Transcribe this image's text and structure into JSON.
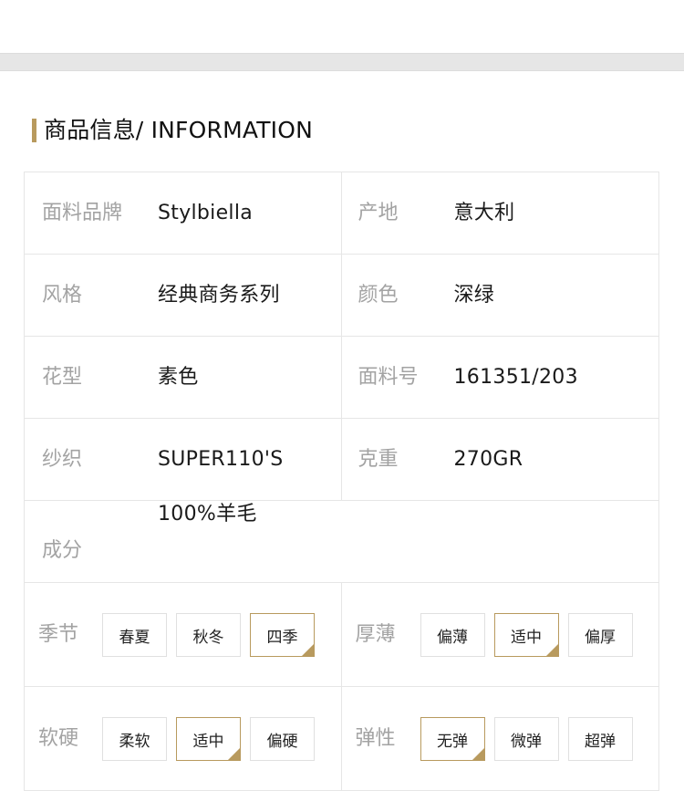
{
  "section": {
    "title": "商品信息/ INFORMATION"
  },
  "info_rows": [
    {
      "left_label": "面料品牌",
      "left_value": "Stylbiella",
      "right_label": "产地",
      "right_value": "意大利"
    },
    {
      "left_label": "风格",
      "left_value": "经典商务系列",
      "right_label": "颜色",
      "right_value": "深绿"
    },
    {
      "left_label": "花型",
      "left_value": "素色",
      "right_label": "面料号",
      "right_value": "161351/203"
    },
    {
      "left_label": "纱织",
      "left_value": "SUPER110'S",
      "right_label": "克重",
      "right_value": "270GR"
    }
  ],
  "composition": {
    "label": "成分",
    "value": "100%羊毛"
  },
  "attributes": {
    "season": {
      "label": "季节",
      "options": [
        "春夏",
        "秋冬",
        "四季"
      ],
      "selected": "四季"
    },
    "thickness": {
      "label": "厚薄",
      "options": [
        "偏薄",
        "适中",
        "偏厚"
      ],
      "selected": "适中"
    },
    "softness": {
      "label": "软硬",
      "options": [
        "柔软",
        "适中",
        "偏硬"
      ],
      "selected": "适中"
    },
    "elasticity": {
      "label": "弹性",
      "options": [
        "无弹",
        "微弹",
        "超弹"
      ],
      "selected": "无弹"
    }
  },
  "colors": {
    "accent": "#b89a5e",
    "border": "#e6e6e6",
    "label": "#a3a3a3",
    "band": "#e6e6e6"
  }
}
